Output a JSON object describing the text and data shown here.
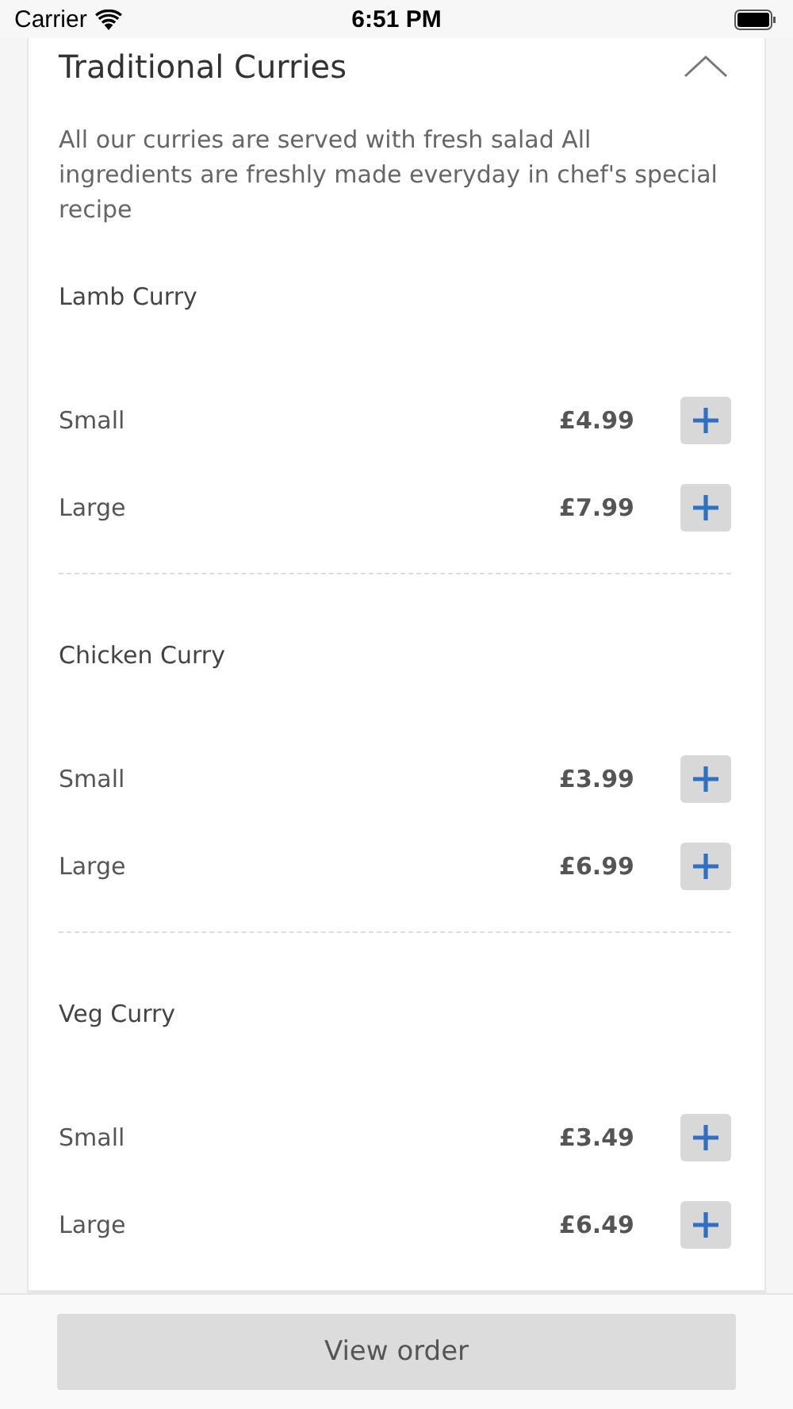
{
  "status_bar": {
    "carrier": "Carrier",
    "time": "6:51 PM"
  },
  "section": {
    "title": "Traditional Curries",
    "expanded": true,
    "description": "All our curries are served with fresh salad All ingredients are freshly made everyday in chef's special recipe",
    "items": [
      {
        "name": "Lamb Curry",
        "options": [
          {
            "size": "Small",
            "price": "£4.99"
          },
          {
            "size": "Large",
            "price": "£7.99"
          }
        ]
      },
      {
        "name": "Chicken Curry",
        "options": [
          {
            "size": "Small",
            "price": "£3.99"
          },
          {
            "size": "Large",
            "price": "£6.99"
          }
        ]
      },
      {
        "name": "Veg Curry",
        "options": [
          {
            "size": "Small",
            "price": "£3.49"
          },
          {
            "size": "Large",
            "price": "£6.49"
          }
        ]
      }
    ]
  },
  "view_order_button": "View order"
}
